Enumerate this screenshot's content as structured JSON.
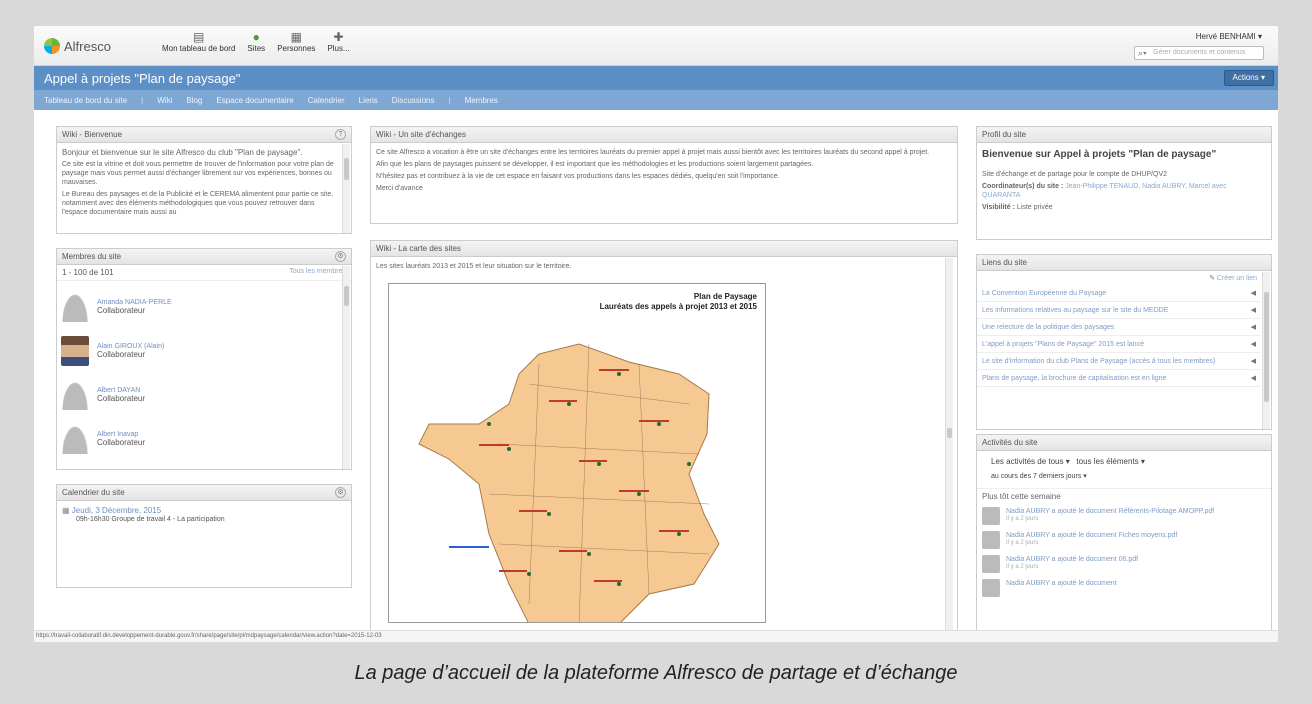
{
  "caption": "La page d’accueil de la plateforme Alfresco de partage et d’échange",
  "header": {
    "logo_text": "Alfresco",
    "nav": [
      {
        "label": "Mon tableau de bord",
        "icon": "dashboard-icon"
      },
      {
        "label": "Sites",
        "icon": "sites-icon"
      },
      {
        "label": "Personnes",
        "icon": "people-icon"
      },
      {
        "label": "Plus...",
        "icon": "plus-icon"
      }
    ],
    "user": "Hervé BENHAMI ▾",
    "search_placeholder": "Gérer documents et contenus"
  },
  "site": {
    "title": "Appel à projets \"Plan de paysage\"",
    "actions": "Actions ▾",
    "nav": [
      "Tableau de bord du site",
      "Wiki",
      "Blog",
      "Espace documentaire",
      "Calendrier",
      "Liens",
      "Discussions",
      "Membres"
    ]
  },
  "wiki_welcome": {
    "title": "Wiki - Bienvenue",
    "paragraphs": [
      "Bonjour et bienvenue sur le site Alfresco du club \"Plan de paysage\".",
      "Ce site est la vitrine et doit vous permettre de trouver de l'information pour votre plan de paysage mais vous permet aussi d'échanger librement sur vos expériences, bonnes ou mauvaises.",
      "Le Bureau des paysages et de la Publicité et le CEREMA alimentent pour partie ce site, notamment avec des éléments méthodologiques que vous pouvez retrouver dans l'espace documentaire mais aussi au"
    ]
  },
  "members": {
    "title": "Membres du site",
    "range": "1 - 100 de 101",
    "all_link": "Tous les membres",
    "list": [
      {
        "name": "Amanda NADIA-PERLE",
        "role": "Collaborateur",
        "photo": false
      },
      {
        "name": "Alain GIROUX (Alain)",
        "role": "Collaborateur",
        "photo": true
      },
      {
        "name": "Albert DAYAN",
        "role": "Collaborateur",
        "photo": false
      },
      {
        "name": "Albert Inavap",
        "role": "Collaborateur",
        "photo": false
      }
    ]
  },
  "calendar": {
    "title": "Calendrier du site",
    "date": "Jeudi, 3 Décembre, 2015",
    "event": "09h-16h30 Groupe de travail 4 - La participation"
  },
  "wiki_exchange": {
    "title": "Wiki - Un site d'échanges",
    "paragraphs": [
      "Ce site Alfresco a vocation à être un site d'échanges entre les territoires lauréats du premier appel à projet mais aussi bientôt avec les territoires lauréats du second appel à projet.",
      "Afin que les plans de paysages puissent se développer, il est important que les méthodologies et les productions soient largement partagées.",
      "N'hésitez pas et contribuez à la vie de cet espace en faisant vos productions dans les espaces dédiés, quelqu'en soit l'importance.",
      "Merci d'avance"
    ]
  },
  "wiki_map": {
    "title": "Wiki - La carte des sites",
    "intro": "Les sites lauréats 2013 et 2015 et leur situation sur le territoire.",
    "map_title": "Plan de Paysage",
    "map_subtitle": "Lauréats des appels à projet 2013 et 2015"
  },
  "site_profile": {
    "title": "Profil du site",
    "heading": "Bienvenue sur Appel à projets \"Plan de paysage\"",
    "description": "Site d'échange et de partage pour le compte de DHUP/QV2",
    "coordinators_label": "Coordinateur(s) du site :",
    "coordinators": "Jean-Philippe TENAUD, Nadia AUBRY, Marcel avec QUARANTA",
    "visibility_label": "Visibilité :",
    "visibility": "Liste privée"
  },
  "site_links": {
    "title": "Liens du site",
    "create": "Créer un lien",
    "items": [
      "La Convention Européenne du Paysage",
      "Les informations relatives au paysage sur le site du MEDDE",
      "Une relecture de la politique des paysages",
      "L'appel à projets \"Plans de Paysage\" 2015 est lancé",
      "Le site d'information du club Plans de Paysage (accès à tous les membres)",
      "Plans de paysage, la brochure de capitalisation est en ligne"
    ]
  },
  "activities": {
    "title": "Activités du site",
    "filter_who": "Les activités de tous ▾",
    "filter_what": "tous les éléments ▾",
    "filter_when": "au cours des 7 derniers jours ▾",
    "section": "Plus tôt cette semaine",
    "items": [
      {
        "text": "Nadia AUBRY a ajouté le document Référents-Pilotage AMOPP.pdf",
        "time": "Il y a 2 jours"
      },
      {
        "text": "Nadia AUBRY a ajouté le document Fiches moyens.pdf",
        "time": "Il y a 2 jours"
      },
      {
        "text": "Nadia AUBRY a ajouté le document 06.pdf",
        "time": "Il y a 2 jours"
      },
      {
        "text": "Nadia AUBRY a ajouté le document",
        "time": ""
      }
    ]
  },
  "status_url": "https://travail-collaboratif.din.developpement-durable.gouv.fr/share/page/site/pl/mdpaysage/calendar/view.action?date=2015-12-03"
}
